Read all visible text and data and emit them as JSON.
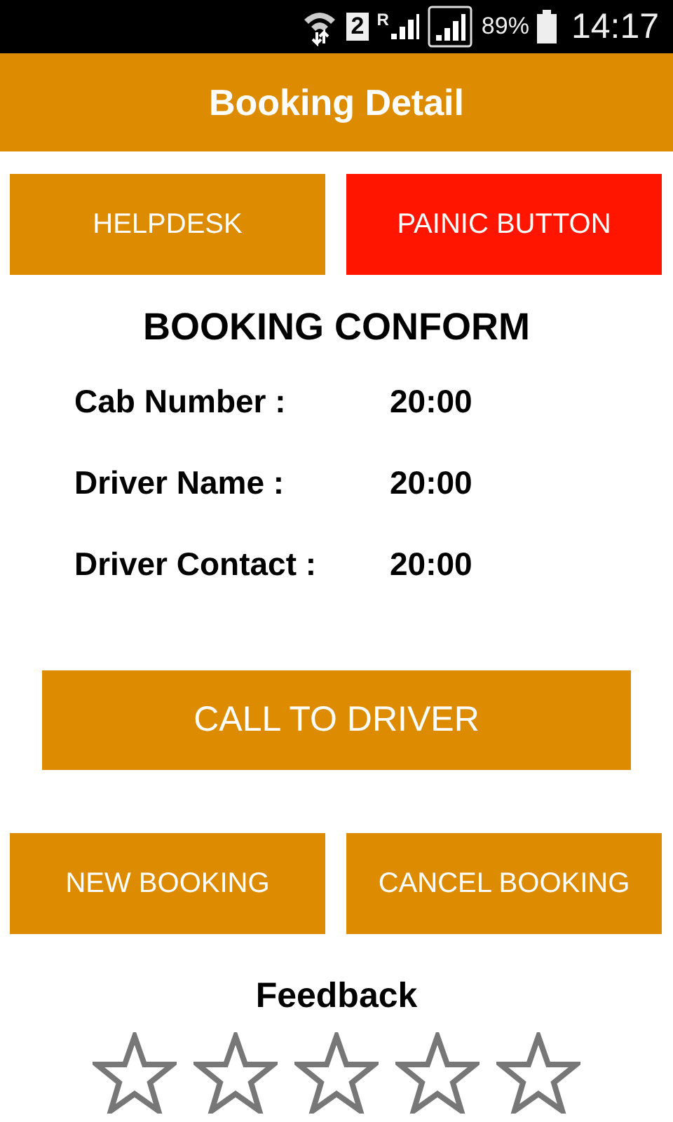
{
  "status_bar": {
    "sim_number": "2",
    "roaming": "R",
    "battery": "89%",
    "time": "14:17"
  },
  "app_bar": {
    "title": "Booking Detail"
  },
  "top_buttons": [
    {
      "label": "HELPDESK",
      "kind": "normal"
    },
    {
      "label": "PAINIC BUTTON",
      "kind": "alert"
    }
  ],
  "heading": "BOOKING CONFORM",
  "details": [
    {
      "label": "Cab Number :",
      "value": "20:00"
    },
    {
      "label": "Driver Name :",
      "value": "20:00"
    },
    {
      "label": "Driver Contact :",
      "value": "20:00"
    }
  ],
  "call_button": "CALL TO DRIVER",
  "bottom_buttons": [
    "NEW BOOKING",
    "CANCEL BOOKING"
  ],
  "feedback": {
    "title": "Feedback",
    "stars": 0
  }
}
